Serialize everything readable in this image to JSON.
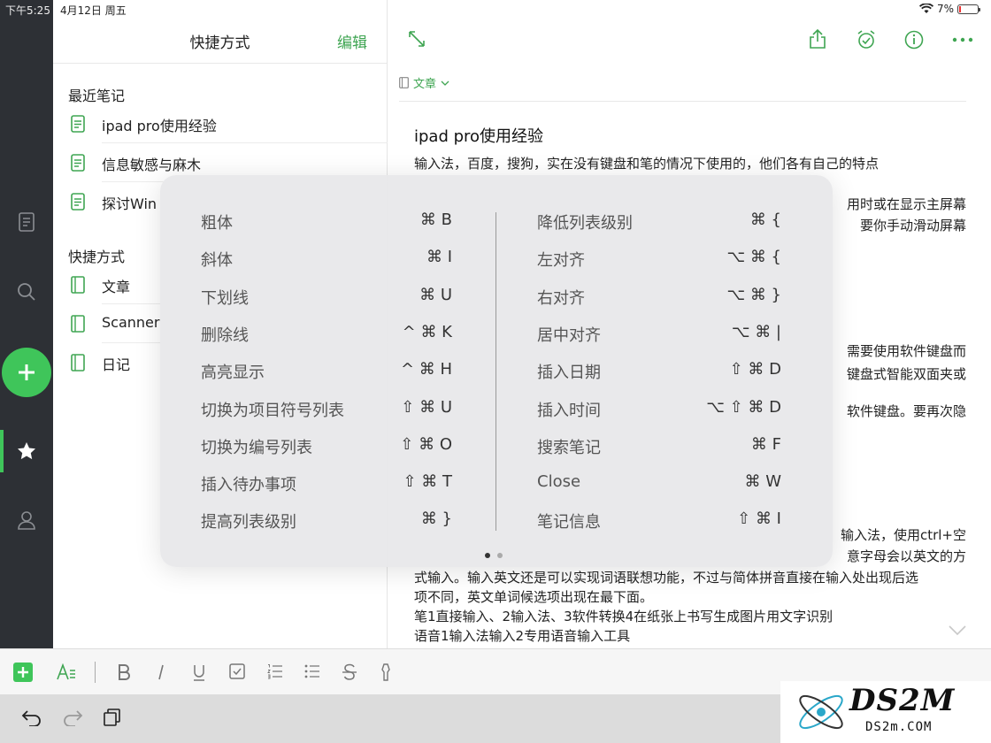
{
  "status": {
    "time": "下午5:25",
    "date": "4月12日 周五",
    "battery": "7%"
  },
  "sidebar": {
    "title": "快捷方式",
    "edit": "编辑"
  },
  "recent": {
    "title": "最近笔记",
    "items": [
      "ipad pro使用经验",
      "信息敏感与麻木",
      "探讨Win"
    ]
  },
  "shortcuts": {
    "title": "快捷方式",
    "items": [
      "文章",
      "Scanner",
      "日记"
    ]
  },
  "note": {
    "notebook": "文章",
    "title": "ipad pro使用经验",
    "line1": "输入法，百度，搜狗，实在没有键盘和笔的情况下使用的，他们各有自己的特点",
    "r1": "用时或在显示主屏幕",
    "r2": "要你手动滑动屏幕",
    "r3": "需要使用软件键盘而",
    "r4": "键盘式智能双面夹或",
    "r5": "软件键盘。要再次隐",
    "r6": "输入法，使用ctrl+空",
    "r7": "意字母会以英文的方",
    "line8": "式输入。输入英文还是可以实现词语联想功能，不过与简体拼音直接在输入处出现后选",
    "line9": "项不同，英文单词候选项出现在最下面。",
    "line10": "笔1直接输入、2输入法、3软件转换4在纸张上书写生成图片用文字识别",
    "line11": "语音1输入法输入2专用语音输入工具"
  },
  "overlay": {
    "left": [
      {
        "name": "粗体",
        "keys": "⌘ B"
      },
      {
        "name": "斜体",
        "keys": "⌘ I"
      },
      {
        "name": "下划线",
        "keys": "⌘ U"
      },
      {
        "name": "删除线",
        "keys": "^ ⌘ K"
      },
      {
        "name": "高亮显示",
        "keys": "^ ⌘ H"
      },
      {
        "name": "切换为项目符号列表",
        "keys": "⇧ ⌘ U"
      },
      {
        "name": "切换为编号列表",
        "keys": "⇧ ⌘ O"
      },
      {
        "name": "插入待办事项",
        "keys": "⇧ ⌘ T"
      },
      {
        "name": "提高列表级别",
        "keys": "⌘ }"
      }
    ],
    "right": [
      {
        "name": "降低列表级别",
        "keys": "⌘ {"
      },
      {
        "name": "左对齐",
        "keys": "⌥ ⌘ {"
      },
      {
        "name": "右对齐",
        "keys": "⌥ ⌘ }"
      },
      {
        "name": "居中对齐",
        "keys": "⌥ ⌘ |"
      },
      {
        "name": "插入日期",
        "keys": "⇧ ⌘ D"
      },
      {
        "name": "插入时间",
        "keys": "⌥ ⇧ ⌘ D"
      },
      {
        "name": "搜索笔记",
        "keys": "⌘ F"
      },
      {
        "name": "Close",
        "keys": "⌘ W"
      },
      {
        "name": "笔记信息",
        "keys": "⇧ ⌘ I"
      }
    ]
  },
  "watermark": {
    "big": "DS2M",
    "small": "DS2m.COM"
  },
  "colors": {
    "accent": "#3fc55a",
    "rail": "#2d3035"
  }
}
